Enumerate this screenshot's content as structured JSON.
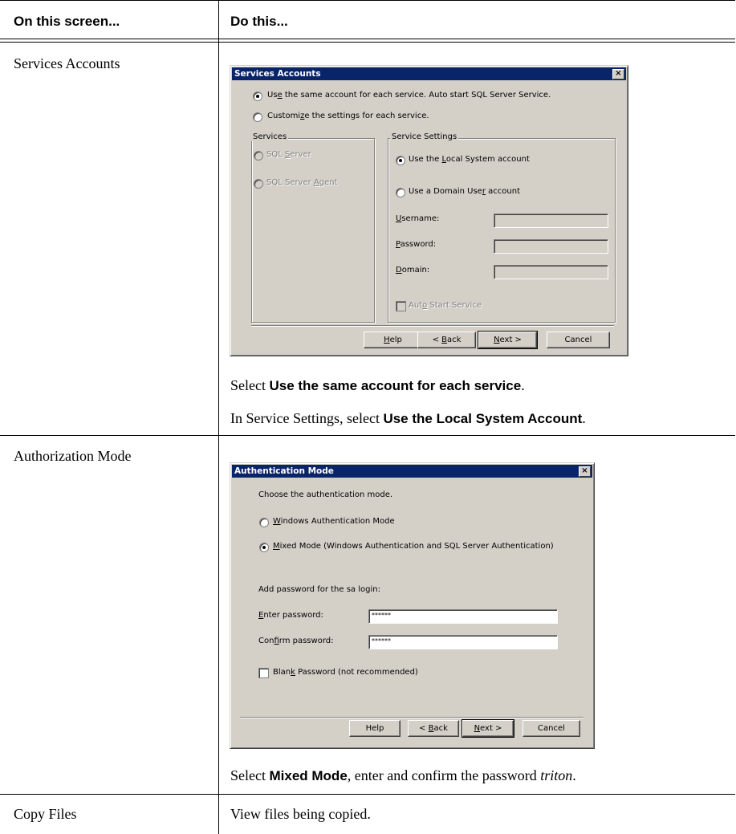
{
  "table": {
    "header_left": "On this screen...",
    "header_right": "Do this...",
    "rows": [
      {
        "screen": "Services Accounts",
        "instructions": [
          {
            "pre": "Select ",
            "bold": "Use the same account for each service",
            "post": "."
          },
          {
            "pre": "In Service Settings, select ",
            "bold": "Use the Local System Account",
            "post": "."
          }
        ]
      },
      {
        "screen": "Authorization Mode",
        "instructions": [
          {
            "pre": "Select ",
            "bold": "Mixed Mode",
            "mid": ", enter and confirm the password ",
            "italic": "triton",
            "post": "."
          }
        ]
      },
      {
        "screen": "Copy Files",
        "instructions": [
          {
            "text": "View files being copied."
          }
        ]
      }
    ]
  },
  "services_dialog": {
    "title": "Services Accounts",
    "close": "×",
    "option_same": {
      "a": "Us",
      "u": "e",
      "b": " the same account for each service. Auto start SQL Server Service."
    },
    "option_custom": {
      "a": "Customi",
      "u": "z",
      "b": "e the settings for each service."
    },
    "services_group": "Services",
    "svc_sql": {
      "a": "SQL ",
      "u": "S",
      "b": "erver"
    },
    "svc_agent": {
      "a": "SQL Server ",
      "u": "A",
      "b": "gent"
    },
    "settings_group": "Service Settings",
    "local_system": {
      "a": "Use the ",
      "u": "L",
      "b": "ocal System account"
    },
    "domain_user": {
      "a": "Use a Domain Use",
      "u": "r",
      "b": " account"
    },
    "username": {
      "u": "U",
      "b": "sername:"
    },
    "password": {
      "u": "P",
      "b": "assword:"
    },
    "domain": {
      "u": "D",
      "b": "omain:"
    },
    "auto_start": {
      "a": "Aut",
      "u": "o",
      "b": " Start Service"
    },
    "buttons": {
      "help": {
        "u": "H",
        "b": "elp"
      },
      "back": {
        "a": "< ",
        "u": "B",
        "b": "ack"
      },
      "next": {
        "u": "N",
        "b": "ext >"
      },
      "cancel": "Cancel"
    }
  },
  "auth_dialog": {
    "title": "Authentication Mode",
    "close": "×",
    "prompt": "Choose the authentication mode.",
    "windows_mode": {
      "u": "W",
      "b": "indows Authentication Mode"
    },
    "mixed_mode": {
      "u": "M",
      "b": "ixed Mode (Windows Authentication and SQL Server Authentication)"
    },
    "sa_prompt": "Add password for the sa login:",
    "enter_password": {
      "u": "E",
      "b": "nter password:"
    },
    "enter_value": "******",
    "confirm_password": {
      "a": "Con",
      "u": "f",
      "b": "irm password:"
    },
    "confirm_value": "******",
    "blank_password": {
      "a": "Blan",
      "u": "k",
      "b": " Password (not recommended)"
    },
    "buttons": {
      "help": "Help",
      "back": {
        "a": "< ",
        "u": "B",
        "b": "ack"
      },
      "next": {
        "u": "N",
        "b": "ext >"
      },
      "cancel": "Cancel"
    }
  }
}
